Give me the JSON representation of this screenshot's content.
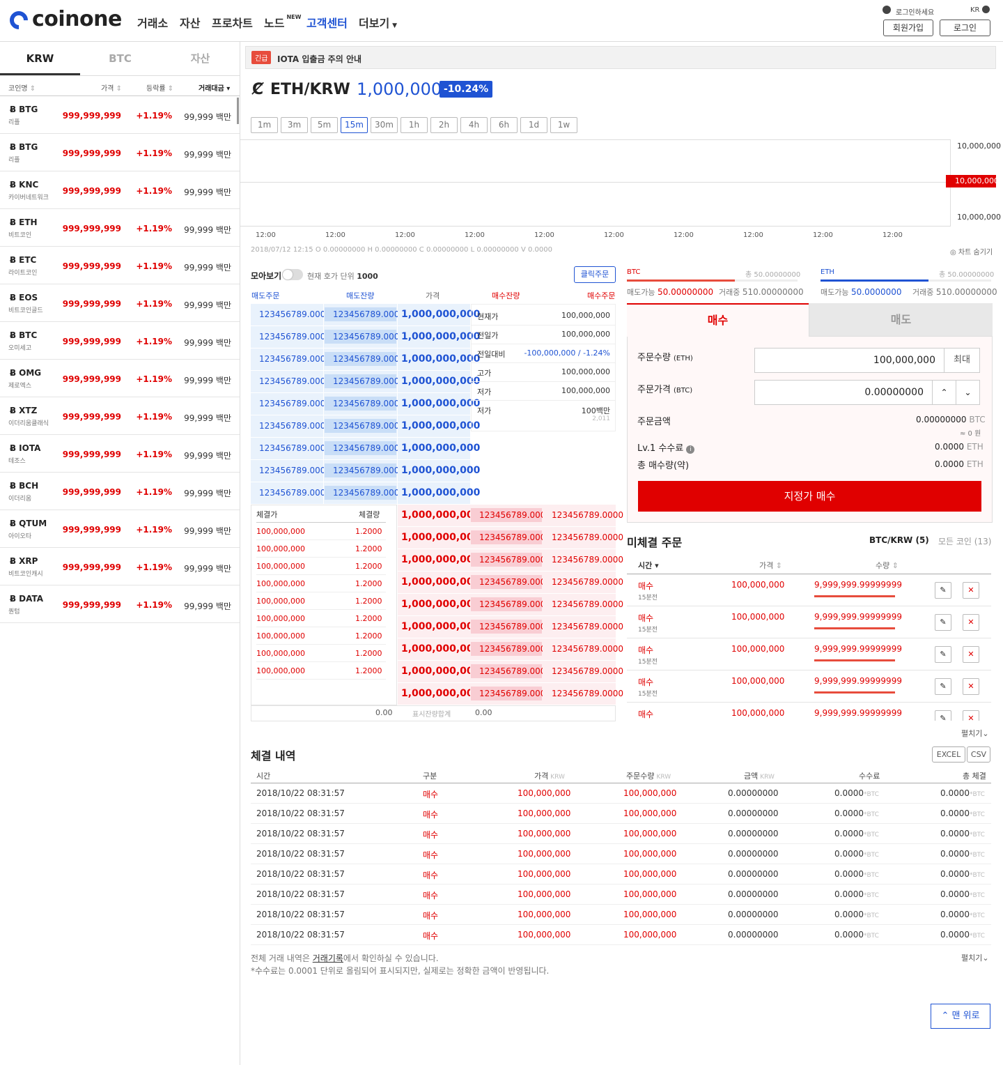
{
  "header": {
    "logo": "coinone",
    "nav": [
      {
        "label": "거래소"
      },
      {
        "label": "자산"
      },
      {
        "label": "프로차트"
      },
      {
        "label": "노드",
        "badge": "NEW"
      },
      {
        "label": "고객센터"
      },
      {
        "label": "더보기"
      }
    ],
    "login_prompt": "로그인하세요",
    "lang": "KR",
    "signup": "회원가입",
    "login": "로그인"
  },
  "sidebar": {
    "tabs": [
      "KRW",
      "BTC",
      "자산"
    ],
    "columns": [
      "코인명",
      "가격",
      "등락률",
      "거래대금"
    ],
    "coins": [
      {
        "sym": "BTG",
        "name": "리플",
        "price": "999,999,999",
        "chg": "+1.19%",
        "vol": "99,999 백만"
      },
      {
        "sym": "BTG",
        "name": "리플",
        "price": "999,999,999",
        "chg": "+1.19%",
        "vol": "99,999 백만"
      },
      {
        "sym": "KNC",
        "name": "카이버네트워크",
        "price": "999,999,999",
        "chg": "+1.19%",
        "vol": "99,999 백만"
      },
      {
        "sym": "ETH",
        "name": "비트코인",
        "price": "999,999,999",
        "chg": "+1.19%",
        "vol": "99,999 백만"
      },
      {
        "sym": "ETC",
        "name": "라이트코인",
        "price": "999,999,999",
        "chg": "+1.19%",
        "vol": "99,999 백만"
      },
      {
        "sym": "EOS",
        "name": "비트코인골드",
        "price": "999,999,999",
        "chg": "+1.19%",
        "vol": "99,999 백만"
      },
      {
        "sym": "BTC",
        "name": "오미세고",
        "price": "999,999,999",
        "chg": "+1.19%",
        "vol": "99,999 백만"
      },
      {
        "sym": "OMG",
        "name": "제로엑스",
        "price": "999,999,999",
        "chg": "+1.19%",
        "vol": "99,999 백만"
      },
      {
        "sym": "XTZ",
        "name": "이더리움클래식",
        "price": "999,999,999",
        "chg": "+1.19%",
        "vol": "99,999 백만"
      },
      {
        "sym": "IOTA",
        "name": "테조스",
        "price": "999,999,999",
        "chg": "+1.19%",
        "vol": "99,999 백만"
      },
      {
        "sym": "BCH",
        "name": "이더리움",
        "price": "999,999,999",
        "chg": "+1.19%",
        "vol": "99,999 백만"
      },
      {
        "sym": "QTUM",
        "name": "아이오타",
        "price": "999,999,999",
        "chg": "+1.19%",
        "vol": "99,999 백만"
      },
      {
        "sym": "XRP",
        "name": "비트코인캐시",
        "price": "999,999,999",
        "chg": "+1.19%",
        "vol": "99,999 백만"
      },
      {
        "sym": "DATA",
        "name": "퀀텀",
        "price": "999,999,999",
        "chg": "+1.19%",
        "vol": "99,999 백만"
      }
    ]
  },
  "notice": {
    "badge": "긴급",
    "text": "IOTA 입출금 주의 안내"
  },
  "ticker": {
    "pair": "ETH/KRW",
    "price": "1,000,000",
    "change": "-10.24%"
  },
  "timeframes": [
    "1m",
    "3m",
    "5m",
    "15m",
    "30m",
    "1h",
    "2h",
    "4h",
    "6h",
    "1d",
    "1w"
  ],
  "chart": {
    "y_labels": [
      "10,000,000",
      "10,000,000",
      "10,000,000"
    ],
    "x_labels": [
      "12:00",
      "12:00",
      "12:00",
      "12:00",
      "12:00",
      "12:00",
      "12:00",
      "12:00",
      "12:00",
      "12:00"
    ],
    "info": "2018/07/12 12:15  O 0.00000000  H 0.00000000  C 0.00000000  L 0.00000000  V 0.0000",
    "hide": "차트 숨기기"
  },
  "orderbook": {
    "group_label": "모아보기",
    "unit_label": "현재 호가 단위",
    "unit": "1000",
    "click_order": "클릭주문",
    "headers": [
      "매도주문",
      "매도잔량",
      "가격",
      "매수잔량",
      "매수주문"
    ],
    "ask_qty": "123456789.0000",
    "price": "1,000,000,000",
    "stats": [
      {
        "k": "현재가",
        "v": "100,000,000"
      },
      {
        "k": "전일가",
        "v": "100,000,000"
      },
      {
        "k": "전일대비",
        "v": "-100,000,000 / -1.24%"
      },
      {
        "k": "고가",
        "v": "100,000,000"
      },
      {
        "k": "저가",
        "v": "100,000,000"
      },
      {
        "k": "저가",
        "v": "100백만",
        "sub": "2,011"
      }
    ],
    "trade_headers": [
      "체결가",
      "체결량"
    ],
    "trade_price": "100,000,000",
    "trade_qty": "1.2000",
    "footer": {
      "left": "0.00",
      "mid": "표시잔량합계",
      "right": "0.00"
    }
  },
  "balances": {
    "btc": {
      "name": "BTC",
      "total": "총 50.00000000",
      "avail_label": "매도가능",
      "avail": "50.00000000",
      "pending_label": "거래중",
      "pending": "510.00000000"
    },
    "eth": {
      "name": "ETH",
      "total": "총 50.00000000",
      "avail_label": "매도가능",
      "avail": "50.0000000",
      "pending_label": "거래중",
      "pending": "510.00000000"
    }
  },
  "order_form": {
    "buy_tab": "매수",
    "sell_tab": "매도",
    "qty_label": "주문수량",
    "qty_unit": "(ETH)",
    "qty_value": "100,000,000",
    "max": "최대",
    "price_label": "주문가격",
    "price_unit": "(BTC)",
    "price_value": "0.00000000",
    "amount_label": "주문금액",
    "amount": "0.00000000",
    "amount_unit": "BTC",
    "amount_krw": "≈ 0 원",
    "fee_label": "Lv.1 수수료",
    "fee": "0.0000",
    "fee_unit": "ETH",
    "total_label": "총 매수량(약)",
    "total": "0.0000",
    "total_unit": "ETH",
    "submit": "지정가 매수"
  },
  "open_orders": {
    "title": "미체결 주문",
    "filter1": "BTC/KRW (5)",
    "filter2": "모든 코인 (13)",
    "headers": [
      "시간",
      "가격",
      "수량"
    ],
    "rows": [
      {
        "side": "매수",
        "time": "15분전",
        "price": "100,000,000",
        "qty": "9,999,999.99999999"
      },
      {
        "side": "매수",
        "time": "15분전",
        "price": "100,000,000",
        "qty": "9,999,999.99999999"
      },
      {
        "side": "매수",
        "time": "15분전",
        "price": "100,000,000",
        "qty": "9,999,999.99999999"
      },
      {
        "side": "매수",
        "time": "15분전",
        "price": "100,000,000",
        "qty": "9,999,999.99999999"
      },
      {
        "side": "매수",
        "time": "",
        "price": "100,000,000",
        "qty": "9,999,999.99999999"
      }
    ],
    "expand": "펼치기"
  },
  "history": {
    "title": "체결 내역",
    "excel": "EXCEL",
    "csv": "CSV",
    "headers": [
      "시간",
      "구분",
      "가격",
      "주문수량",
      "금액",
      "수수료",
      "총 체결"
    ],
    "header_units": [
      "",
      "",
      "KRW",
      "KRW",
      "KRW",
      "",
      ""
    ],
    "row": {
      "time": "2018/10/22 08:31:57",
      "side": "매수",
      "price": "100,000,000",
      "qty": "100,000,000",
      "amount": "0.00000000",
      "fee": "0.0000",
      "fee_unit": "*BTC",
      "total": "0.0000",
      "total_unit": "*BTC"
    },
    "note1_pre": "전체 거래 내역은",
    "note1_link": "거래기록",
    "note1_post": "에서 확인하실 수 있습니다.",
    "note2": "*수수료는 0.0001 단위로 올림되어 표시되지만, 실제로는 정확한 금액이 반영됩니다.",
    "expand": "펼치기"
  },
  "to_top": "맨 위로"
}
